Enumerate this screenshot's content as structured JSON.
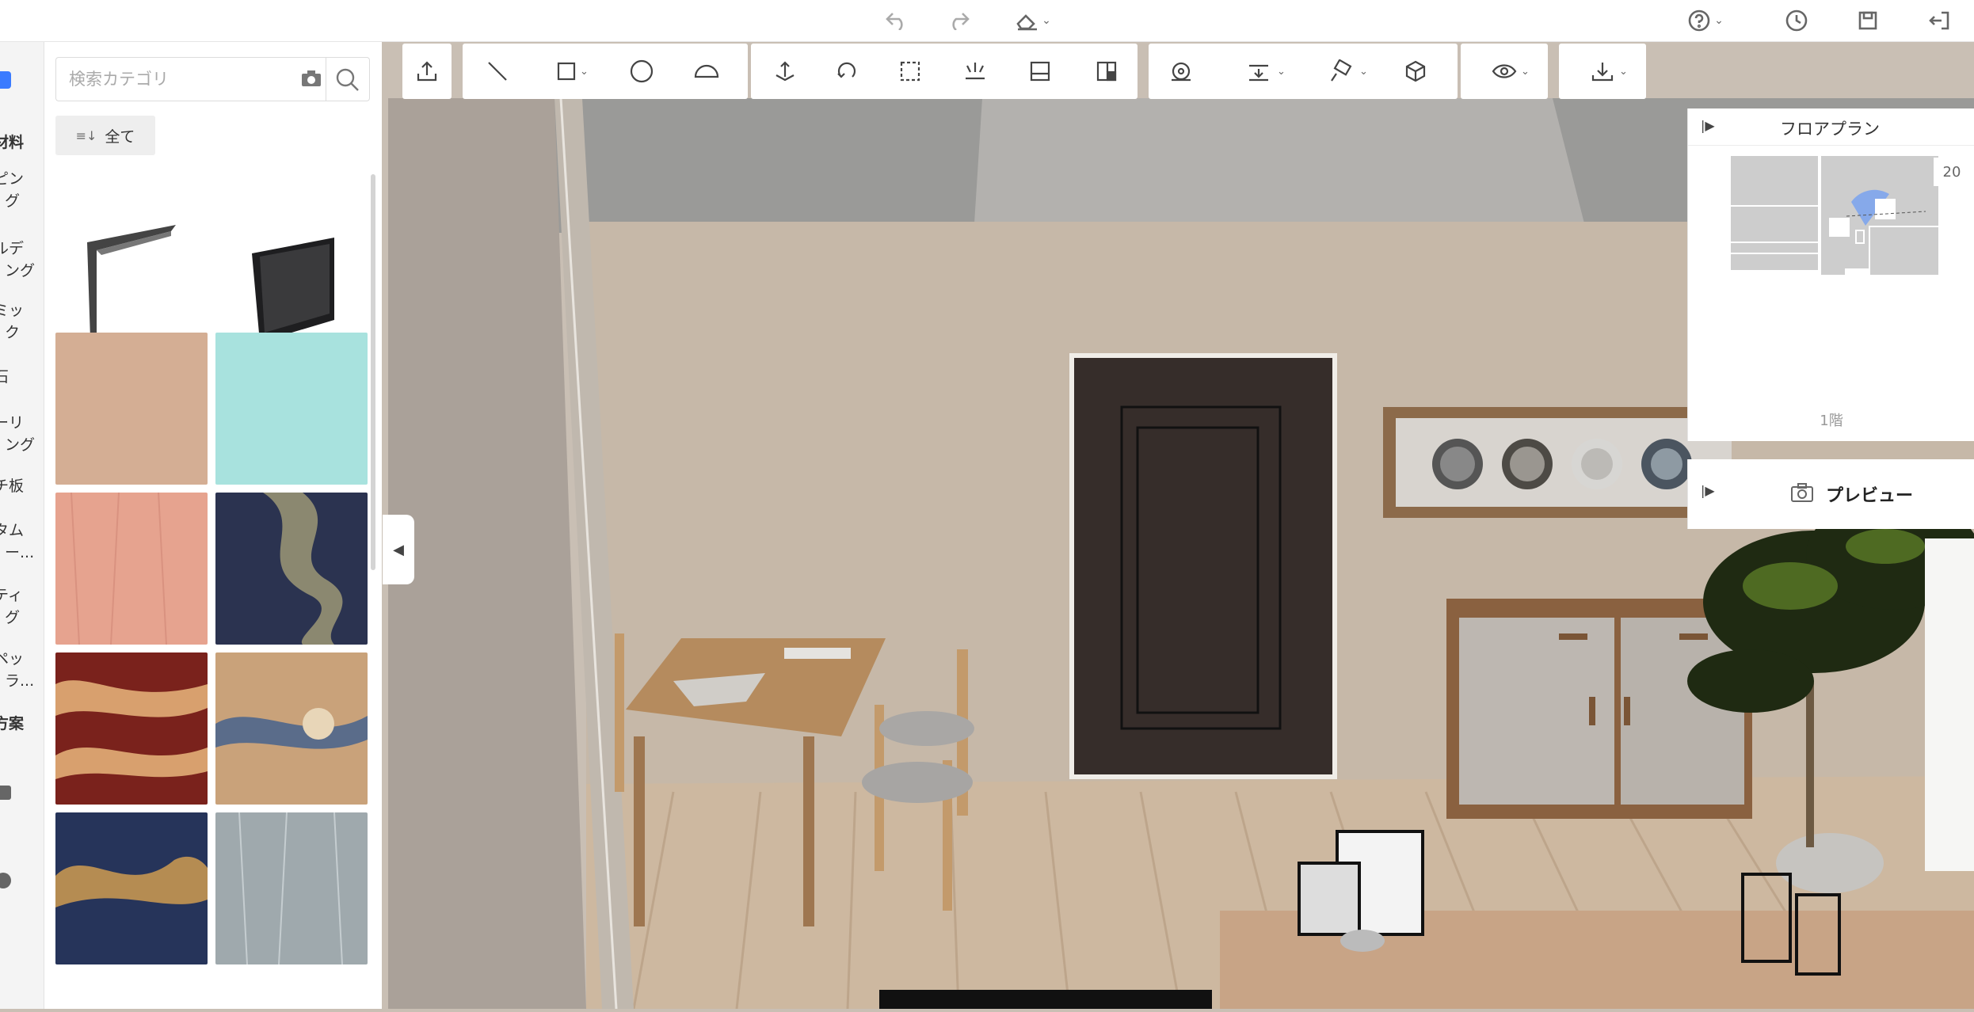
{
  "topbar": {
    "icons": [
      "undo-icon",
      "redo-icon",
      "eraser-icon",
      "help-icon",
      "history-icon",
      "save-icon",
      "exit-icon"
    ]
  },
  "rail": {
    "items": [
      {
        "label": "材料",
        "bold": true
      },
      {
        "label": "ピン\nグ"
      },
      {
        "label": "ルデ\nング"
      },
      {
        "label": "ミッ\nク"
      },
      {
        "label": "石"
      },
      {
        "label": "ーリ\nング"
      },
      {
        "label": "チ板"
      },
      {
        "label": "タム\nー..."
      },
      {
        "label": "ティ\nグ"
      },
      {
        "label": "ペッ\nラ..."
      },
      {
        "label": "方案",
        "bold": true
      }
    ]
  },
  "panel": {
    "search_placeholder": "検索カテゴリ",
    "all_label": "全て",
    "tiles": [
      {
        "kind": "molding-light",
        "color": "#ffffff"
      },
      {
        "kind": "molding-dark",
        "color": "#ffffff"
      },
      {
        "kind": "solid",
        "color": "#d4ae94"
      },
      {
        "kind": "solid",
        "color": "#a8e2de"
      },
      {
        "kind": "texture",
        "color": "#e6a38f"
      },
      {
        "kind": "marble-navy",
        "color": "#2b3350"
      },
      {
        "kind": "wave-red",
        "color": "#7a221c"
      },
      {
        "kind": "wave-sunset",
        "color": "#c9a27a"
      },
      {
        "kind": "wave-navy",
        "color": "#26345a"
      },
      {
        "kind": "pattern-grey",
        "color": "#9fa9ad"
      }
    ]
  },
  "toolbar": {
    "tools": [
      "export-icon",
      "line-icon",
      "rectangle-icon",
      "circle-icon",
      "arc-icon",
      "move-up-icon",
      "rotate-icon",
      "select-area-icon",
      "light-icon",
      "door-icon",
      "layout-icon",
      "measure-icon",
      "align-icon",
      "paint-icon",
      "cube-icon",
      "eye-icon",
      "download-icon"
    ]
  },
  "floorplan": {
    "title": "フロアプラン",
    "zoom": "20",
    "floor_label": "1階"
  },
  "preview": {
    "label": "プレビュー"
  }
}
